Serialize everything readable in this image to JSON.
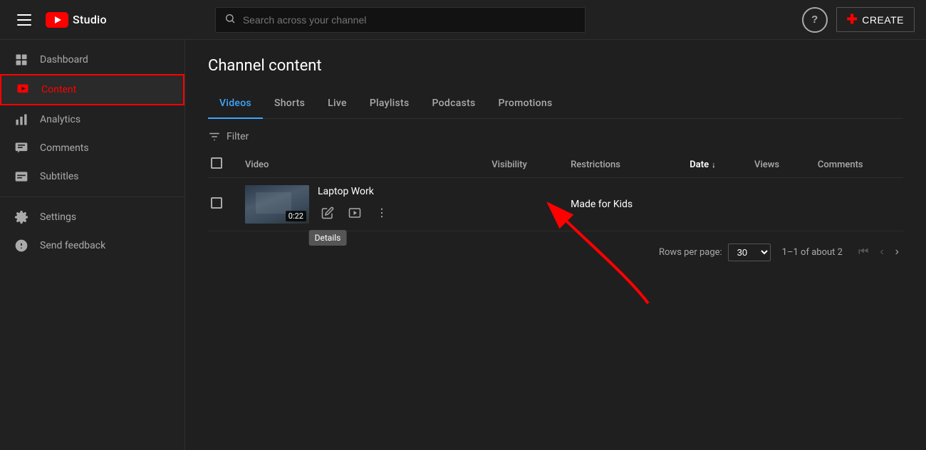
{
  "topbar": {
    "logo_text": "Studio",
    "search_placeholder": "Search across your channel",
    "help_label": "?",
    "create_label": "CREATE"
  },
  "sidebar": {
    "items": [
      {
        "id": "dashboard",
        "label": "Dashboard",
        "icon": "dashboard-icon"
      },
      {
        "id": "content",
        "label": "Content",
        "icon": "content-icon",
        "active": true
      },
      {
        "id": "analytics",
        "label": "Analytics",
        "icon": "analytics-icon"
      },
      {
        "id": "comments",
        "label": "Comments",
        "icon": "comments-icon"
      },
      {
        "id": "subtitles",
        "label": "Subtitles",
        "icon": "subtitles-icon"
      }
    ],
    "bottom_items": [
      {
        "id": "settings",
        "label": "Settings",
        "icon": "settings-icon"
      },
      {
        "id": "feedback",
        "label": "Send feedback",
        "icon": "feedback-icon"
      }
    ]
  },
  "page": {
    "title": "Channel content"
  },
  "tabs": [
    {
      "id": "videos",
      "label": "Videos",
      "active": true
    },
    {
      "id": "shorts",
      "label": "Shorts"
    },
    {
      "id": "live",
      "label": "Live"
    },
    {
      "id": "playlists",
      "label": "Playlists"
    },
    {
      "id": "podcasts",
      "label": "Podcasts"
    },
    {
      "id": "promotions",
      "label": "Promotions"
    }
  ],
  "filter": {
    "label": "Filter"
  },
  "table": {
    "columns": [
      {
        "id": "checkbox",
        "label": ""
      },
      {
        "id": "video",
        "label": "Video"
      },
      {
        "id": "visibility",
        "label": "Visibility"
      },
      {
        "id": "restrictions",
        "label": "Restrictions"
      },
      {
        "id": "date",
        "label": "Date"
      },
      {
        "id": "views",
        "label": "Views"
      },
      {
        "id": "comments",
        "label": "Comments"
      }
    ],
    "rows": [
      {
        "id": "1",
        "title": "Laptop Work",
        "duration": "0:22",
        "visibility": "",
        "restrictions": "Made for Kids",
        "date": "",
        "views": "",
        "comments": ""
      }
    ]
  },
  "tooltip": {
    "details_label": "Details"
  },
  "pagination": {
    "rows_per_page_label": "Rows per page:",
    "rows_per_page_value": "30",
    "page_info": "1–1 of about 2",
    "first_page_label": "⏮",
    "prev_page_label": "‹",
    "next_page_label": "›"
  }
}
